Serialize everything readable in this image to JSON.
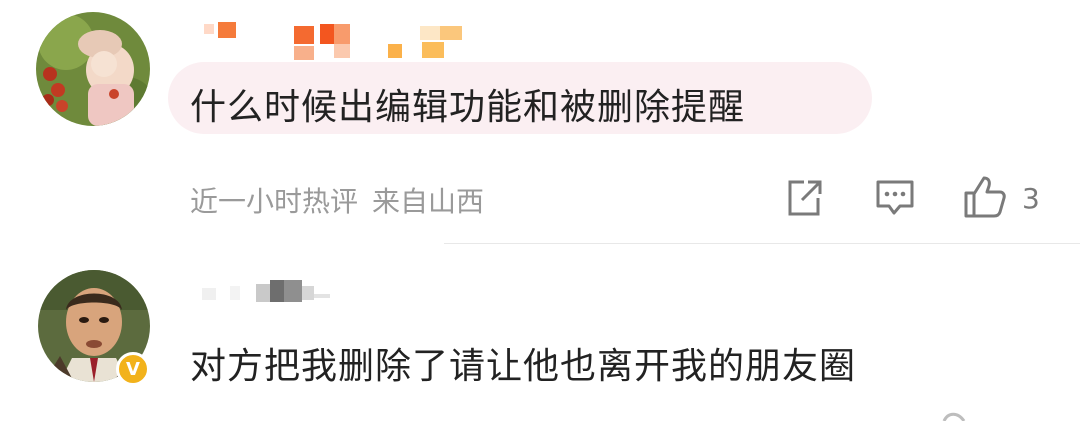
{
  "comments": [
    {
      "text": "什么时候出编辑功能和被删除提醒",
      "time": "近一小时热评",
      "location": "来自山西",
      "like_count": "3"
    },
    {
      "text": "对方把我删除了请让他也离开我的朋友圈",
      "verified_badge": "V"
    }
  ],
  "icons": [
    "share-icon",
    "comment-icon",
    "like-icon"
  ],
  "colors": {
    "bubble": "#fbeff2",
    "meta_text": "#9a9a9a",
    "verified_badge": "#f2b21b"
  }
}
